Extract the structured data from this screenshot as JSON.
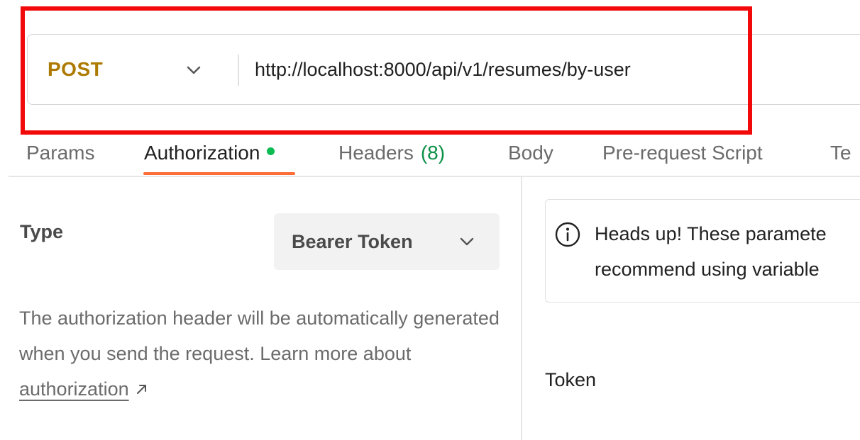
{
  "request": {
    "method": "POST",
    "url": "http://localhost:8000/api/v1/resumes/by-user"
  },
  "tabs": [
    {
      "label": "Params"
    },
    {
      "label": "Authorization",
      "active": true,
      "indicator": "green-dot"
    },
    {
      "label": "Headers",
      "count": "(8)"
    },
    {
      "label": "Body"
    },
    {
      "label": "Pre-request Script"
    },
    {
      "label": "Te"
    }
  ],
  "auth": {
    "type_label": "Type",
    "type_value": "Bearer Token",
    "description": "The authorization header will be automatically generated when you send the request. Learn more about ",
    "link_text": "authorization"
  },
  "notice": {
    "line1": "Heads up! These paramete",
    "line2": "recommend using variable"
  },
  "token": {
    "label": "Token"
  },
  "colors": {
    "method": "#ad7a03",
    "active_tab_underline": "#ff6c37",
    "auth_dot": "#0cbb52",
    "headers_count": "#0c8f46",
    "highlight": "#f20a0a"
  },
  "icons": {
    "method_dropdown": "chevron-down-icon",
    "auth_type_dropdown": "chevron-down-icon",
    "notice": "info-icon",
    "external_link": "arrow-up-right-icon"
  }
}
